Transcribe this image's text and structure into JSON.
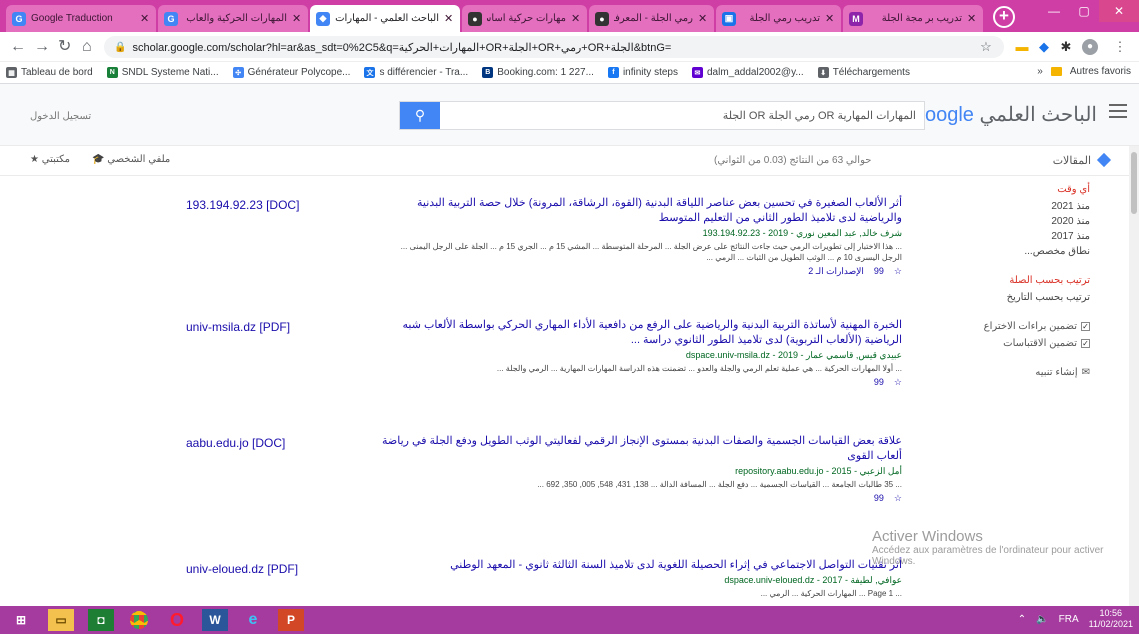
{
  "tabs": [
    {
      "title": "Google Traduction",
      "color": "#4285f4",
      "glyph": "G"
    },
    {
      "title": "المهارات الحركية والعاب",
      "color": "#4285f4",
      "glyph": "G"
    },
    {
      "title": "الباحث العلمي - المهارات",
      "color": "#4285f4",
      "glyph": "◆",
      "active": true
    },
    {
      "title": "مهارات حركية أساسية",
      "color": "#333333",
      "glyph": "●"
    },
    {
      "title": "رمي الجلة - المعرفة",
      "color": "#333333",
      "glyph": "●"
    },
    {
      "title": "تدريب رمي الجلة",
      "color": "#1a73e8",
      "glyph": "▣"
    },
    {
      "title": "تدريب بر مجة الجلة",
      "color": "#8e24aa",
      "glyph": "M"
    }
  ],
  "toolbar": {
    "url": "scholar.google.com/scholar?hl=ar&as_sdt=0%2C5&q=المهارات+الحركية+OR+الجلة+OR+رمي+OR+الجلة&btnG="
  },
  "bookmarks": [
    {
      "label": "Tableau de bord",
      "color": "#5f6368"
    },
    {
      "label": "SNDL Systeme Nati...",
      "color": "#188038"
    },
    {
      "label": "Générateur Polycope...",
      "color": "#4285f4"
    },
    {
      "label": "s différencier - Tra...",
      "color": "#1a73e8"
    },
    {
      "label": "Booking.com: 1 227...",
      "color": "#003580"
    },
    {
      "label": "infinity steps",
      "color": "#1877f2"
    },
    {
      "label": "dalm_addal2002@y...",
      "color": "#6001d2"
    },
    {
      "label": "Téléchargements",
      "color": "#5f6368"
    }
  ],
  "bookmarks_right": "Autres favoris",
  "header": {
    "logo_ar": "الباحث العلمي",
    "logo_en": "Google",
    "search_value": "المهارات المهارية OR رمي الجلة OR الجلة",
    "signin": "تسجيل الدخول"
  },
  "subheader": {
    "articles": "المقالات",
    "results": "حوالي 63 من النتائج (0.03 من الثواني)",
    "my_profile": "ملفي الشخصي",
    "my_library": "مكتبتي"
  },
  "sidebar": {
    "time_head": "أي وقت",
    "time_items": [
      "منذ 2021",
      "منذ 2020",
      "منذ 2017",
      "نطاق مخصص..."
    ],
    "sort_head": "ترتيب بحسب الصلة",
    "sort_items": [
      "ترتيب بحسب التاريخ"
    ],
    "checks": [
      "تضمين براءات الاختراع",
      "تضمين الاقتباسات"
    ],
    "alert": "إنشاء تنبيه"
  },
  "results": [
    {
      "side": "193.194.92.23 [DOC]",
      "title": "أثر الألعاب الصغيرة في تحسين بعض عناصر اللياقة البدنية (القوة، الرشاقة، المرونة) خلال حصة التربية البدنية والرياضية لدى تلاميذ الطور الثاني من التعليم المتوسط",
      "meta": "شرف خالد, عبد المعين نوري - 2019 - 193.194.92.23",
      "snippet": "... هذا الاختبار إلى تطويرات الرمي حيث جاءت النتائج على عرض الجلة ... المرحلة المتوسطة ... المشي 15 م ... الجري 15 م ... الجلة على الرجل اليمنى ... الرجل اليسرى 10 م ... الوثب الطويل من الثبات ... الرمي ..."
    },
    {
      "side": "univ-msila.dz [PDF]",
      "title": "الخبرة المهنية لأساتذة التربية البدنية والرياضية على الرفع من دافعية الأداء المهاري الحركي بواسطة الألعاب شبه الرياضية (الألعاب التربوية) لدى تلاميذ الطور الثانوي دراسة ...",
      "meta": "عبيدي قيس, قاسمي عمار - 2019 - dspace.univ-msila.dz",
      "snippet": "... أولا المهارات الحركية ... هي عملية تعلم الرمي والجلة والعدو ... تضمنت هذه الدراسة المهارات المهارية ... الرمي والجلة ..."
    },
    {
      "side": "aabu.edu.jo [DOC]",
      "title": "علاقة بعض القياسات الجسمية والصفات البدنية بمستوى الإنجاز الرقمي لفعاليتي الوثب الطويل ودفع الجلة في رياضة ألعاب القوى",
      "meta": "أمل الزعبي - 2015 - repository.aabu.edu.jo",
      "snippet": "... 35 طالبات الجامعة ... القياسات الجسمية ... دفع الجلة ... المسافة الدالة ... 138, 431, 548, 005, 350, 692 ..."
    },
    {
      "side": "univ-eloued.dz [PDF]",
      "title": "أثر تقنيات التواصل الاجتماعي في إثراء الحصيلة اللغوية لدى تلاميذ السنة الثالثة ثانوي - المعهد الوطني",
      "meta": "عوافي, لطيفة - 2017 - dspace.univ-eloued.dz",
      "snippet": "... Page 1 ... المهارات الحركية ... الرمي ..."
    }
  ],
  "result_actions": {
    "cite": "99",
    "related": "الإصدارات الـ 2",
    "save": "☆"
  },
  "watermark": {
    "line1": "Activer Windows",
    "line2": "Accédez aux paramètres de l'ordinateur pour activer Windows."
  },
  "taskbar": {
    "lang": "FRA",
    "time": "10:56",
    "date": "11/02/2021"
  },
  "colors": {
    "scholar_blue": "#4285f4",
    "link": "#1a0dab",
    "green": "#006621",
    "tab_strip": "#cf3ea4",
    "taskbar": "#a53b9f"
  }
}
